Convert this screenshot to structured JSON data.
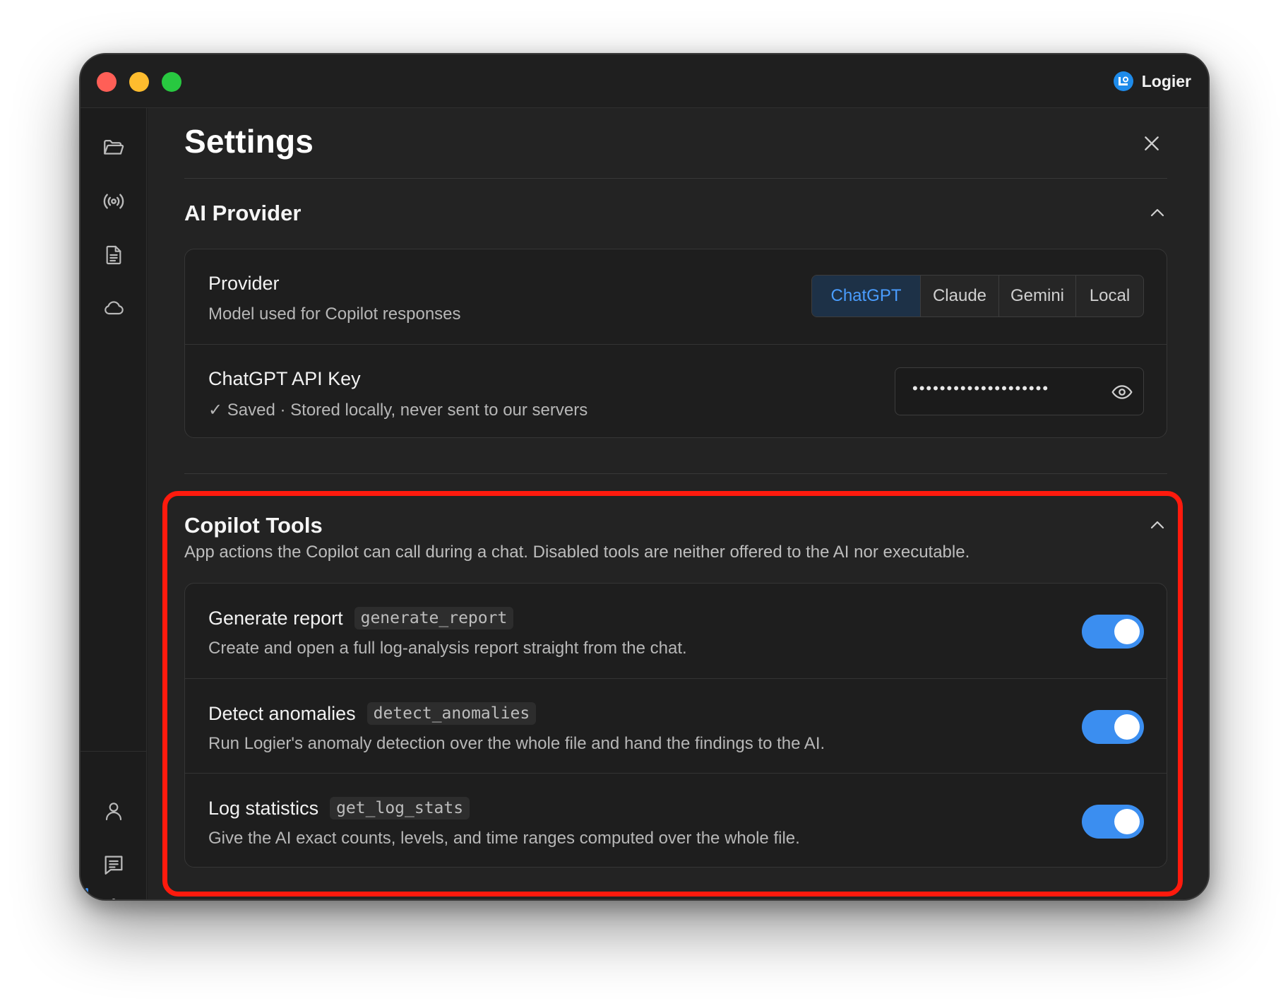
{
  "app": {
    "name": "Logier"
  },
  "sidebar": {
    "top_icons": [
      "folder-icon",
      "broadcast-icon",
      "document-icon",
      "cloud-icon"
    ],
    "bottom_icons": [
      "user-icon",
      "chat-icon",
      "gear-icon"
    ],
    "active_item": "gear-icon"
  },
  "settings": {
    "title": "Settings",
    "ai_provider": {
      "title": "AI Provider",
      "provider": {
        "label": "Provider",
        "description": "Model used for Copilot responses",
        "options": [
          "ChatGPT",
          "Claude",
          "Gemini",
          "Local"
        ],
        "selected": "ChatGPT"
      },
      "api_key": {
        "label": "ChatGPT API Key",
        "description": "✓ Saved · Stored locally, never sent to our servers",
        "masked_value": "••••••••••••••••••••"
      }
    },
    "copilot_tools": {
      "title": "Copilot Tools",
      "description": "App actions the Copilot can call during a chat. Disabled tools are neither offered to the AI nor executable.",
      "tools": [
        {
          "name": "Generate report",
          "id": "generate_report",
          "description": "Create and open a full log-analysis report straight from the chat.",
          "enabled": true
        },
        {
          "name": "Detect anomalies",
          "id": "detect_anomalies",
          "description": "Run Logier's anomaly detection over the whole file and hand the findings to the AI.",
          "enabled": true
        },
        {
          "name": "Log statistics",
          "id": "get_log_stats",
          "description": "Give the AI exact counts, levels, and time ranges computed over the whole file.",
          "enabled": true
        }
      ]
    }
  },
  "colors": {
    "accent": "#3b8ef0",
    "highlight": "#ff1a0d",
    "selected_segment_text": "#4a9dff"
  }
}
